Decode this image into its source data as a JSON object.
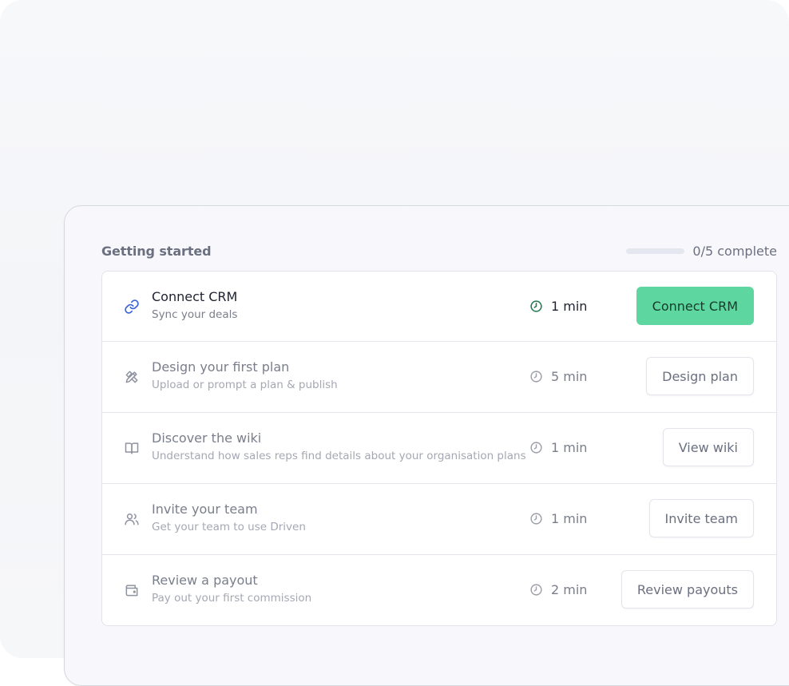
{
  "onboarding": {
    "title": "Getting started",
    "progress_text": "0/5 complete",
    "progress_fraction": 0,
    "accent_color": "#5dd6a0",
    "tasks": [
      {
        "icon": "link-icon",
        "title": "Connect CRM",
        "subtitle": "Sync your deals",
        "duration": "1 min",
        "button": "Connect CRM",
        "active": true
      },
      {
        "icon": "design-tools-icon",
        "title": "Design your first plan",
        "subtitle": "Upload or prompt a plan & publish",
        "duration": "5 min",
        "button": "Design plan",
        "active": false
      },
      {
        "icon": "book-icon",
        "title": "Discover the wiki",
        "subtitle": "Understand how sales reps find details about your organisation plans",
        "duration": "1 min",
        "button": "View wiki",
        "active": false
      },
      {
        "icon": "users-icon",
        "title": "Invite your team",
        "subtitle": "Get your team to use Driven",
        "duration": "1 min",
        "button": "Invite team",
        "active": false
      },
      {
        "icon": "wallet-icon",
        "title": "Review a payout",
        "subtitle": "Pay out your first commission",
        "duration": "2 min",
        "button": "Review payouts",
        "active": false
      }
    ]
  }
}
